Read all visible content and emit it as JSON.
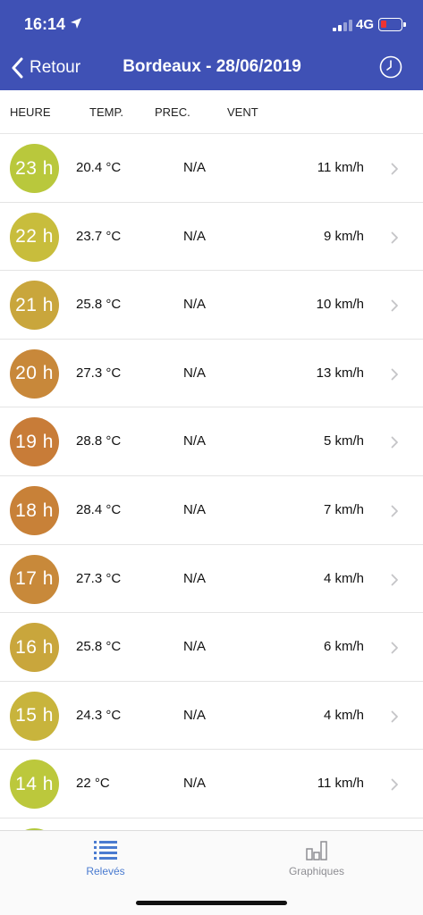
{
  "status_bar": {
    "time": "16:14",
    "network": "4G"
  },
  "nav": {
    "back_label": "Retour",
    "title": "Bordeaux - 28/06/2019"
  },
  "columns": {
    "hour": "HEURE",
    "temp": "TEMP.",
    "prec": "PREC.",
    "wind": "VENT"
  },
  "rows": [
    {
      "hour": "23 h",
      "temp": "20.4 °C",
      "prec": "N/A",
      "wind": "11 km/h",
      "color": "#b9c83c"
    },
    {
      "hour": "22 h",
      "temp": "23.7 °C",
      "prec": "N/A",
      "wind": "9 km/h",
      "color": "#c8bd3c"
    },
    {
      "hour": "21 h",
      "temp": "25.8 °C",
      "prec": "N/A",
      "wind": "10 km/h",
      "color": "#c9a63c"
    },
    {
      "hour": "20 h",
      "temp": "27.3 °C",
      "prec": "N/A",
      "wind": "13 km/h",
      "color": "#c8883a"
    },
    {
      "hour": "19 h",
      "temp": "28.8 °C",
      "prec": "N/A",
      "wind": "5 km/h",
      "color": "#c87c38"
    },
    {
      "hour": "18 h",
      "temp": "28.4 °C",
      "prec": "N/A",
      "wind": "7 km/h",
      "color": "#c88138"
    },
    {
      "hour": "17 h",
      "temp": "27.3 °C",
      "prec": "N/A",
      "wind": "4 km/h",
      "color": "#c8893a"
    },
    {
      "hour": "16 h",
      "temp": "25.8 °C",
      "prec": "N/A",
      "wind": "6 km/h",
      "color": "#c9a63c"
    },
    {
      "hour": "15 h",
      "temp": "24.3 °C",
      "prec": "N/A",
      "wind": "4 km/h",
      "color": "#c8b43c"
    },
    {
      "hour": "14 h",
      "temp": "22 °C",
      "prec": "N/A",
      "wind": "11 km/h",
      "color": "#bcc83c"
    },
    {
      "hour": "",
      "temp": "",
      "prec": "",
      "wind": "",
      "color": "#b2c83c"
    }
  ],
  "tabs": [
    {
      "label": "Relevés",
      "icon": "list-icon",
      "active": true
    },
    {
      "label": "Graphiques",
      "icon": "bar-chart-icon",
      "active": false
    }
  ],
  "colors": {
    "header": "#3f51b5",
    "active_tab": "#4a7bd0",
    "inactive_tab": "#8e8e93"
  }
}
